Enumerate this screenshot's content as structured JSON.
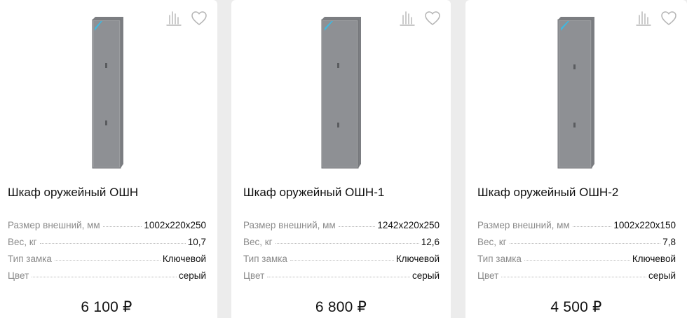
{
  "products": [
    {
      "title": "Шкаф оружейный ОШН",
      "specs": [
        {
          "label": "Размер внешний, мм",
          "value": "1002x220x250"
        },
        {
          "label": "Вес, кг",
          "value": "10,7"
        },
        {
          "label": "Тип замка",
          "value": "Ключевой"
        },
        {
          "label": "Цвет",
          "value": "серый"
        }
      ],
      "price": "6 100 ₽"
    },
    {
      "title": "Шкаф оружейный ОШН-1",
      "specs": [
        {
          "label": "Размер внешний, мм",
          "value": "1242x220x250"
        },
        {
          "label": "Вес, кг",
          "value": "12,6"
        },
        {
          "label": "Тип замка",
          "value": "Ключевой"
        },
        {
          "label": "Цвет",
          "value": "серый"
        }
      ],
      "price": "6 800 ₽"
    },
    {
      "title": "Шкаф оружейный ОШН-2",
      "specs": [
        {
          "label": "Размер внешний, мм",
          "value": "1002x220x150"
        },
        {
          "label": "Вес, кг",
          "value": "7,8"
        },
        {
          "label": "Тип замка",
          "value": "Ключевой"
        },
        {
          "label": "Цвет",
          "value": "серый"
        }
      ],
      "price": "4 500 ₽"
    }
  ],
  "icons": {
    "compare": "compare-icon",
    "favorite": "heart-icon"
  },
  "colors": {
    "card_bg": "#ffffff",
    "page_bg": "#ececec",
    "label": "#8a8a8a",
    "icon": "#b5b5b5",
    "cabinet": "#8e9094"
  }
}
